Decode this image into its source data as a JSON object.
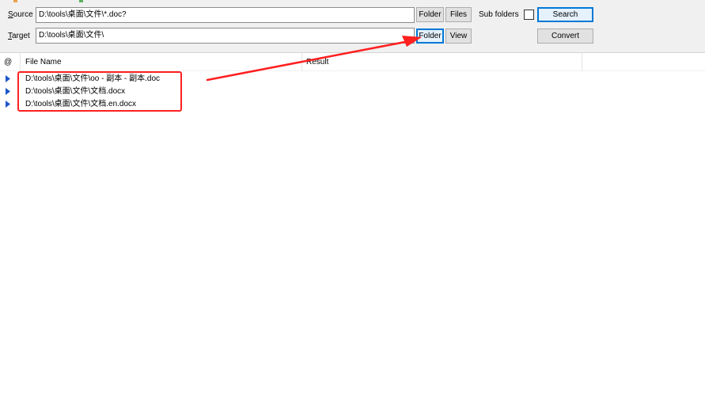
{
  "toolbar": {
    "source_label_prefix": "S",
    "source_label_rest": "ource",
    "source_value": "D:\\tools\\桌面\\文件\\*.doc?",
    "target_label_prefix": "T",
    "target_label_rest": "arget",
    "target_value": "D:\\tools\\桌面\\文件\\",
    "source_folder_label": "Folder",
    "source_files_label": "Files",
    "subfolders_label": "Sub folders",
    "subfolders_checked": false,
    "search_label": "Search",
    "target_folder_label": "Folder",
    "view_label": "View",
    "convert_label": "Convert"
  },
  "grid": {
    "columns": [
      "@",
      "File Name",
      "Result"
    ],
    "rows": [
      {
        "path": "D:\\tools\\桌面\\文件\\oo - 副本 - 副本.doc",
        "result": ""
      },
      {
        "path": "D:\\tools\\桌面\\文件\\文档.docx",
        "result": ""
      },
      {
        "path": "D:\\tools\\桌面\\文件\\文档.en.docx",
        "result": ""
      }
    ]
  },
  "colors": {
    "annotation": "#ff2020",
    "row_arrow": "#1f57c9",
    "focus_border": "#0078d7",
    "panel_bg": "#f0f0f0"
  },
  "icons": [
    "row-arrow-icon",
    "annotation-arrow-icon"
  ]
}
